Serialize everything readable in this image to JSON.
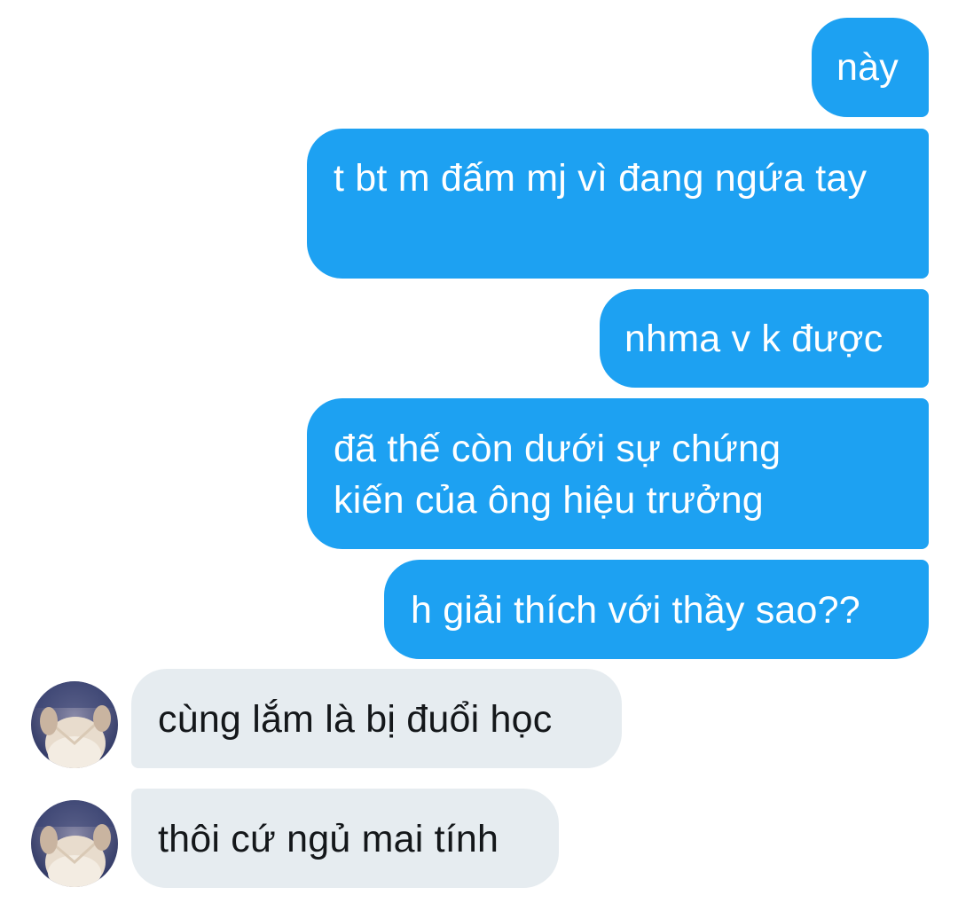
{
  "conversation": {
    "messages": [
      {
        "direction": "sent",
        "text": "này"
      },
      {
        "direction": "sent",
        "text": "t bt m đấm mj vì đang ngứa tay"
      },
      {
        "direction": "sent",
        "text": "nhma v k được"
      },
      {
        "direction": "sent",
        "text": "đã thế còn dưới sự chứng kiến của ông hiệu trưởng"
      },
      {
        "direction": "sent",
        "text": "h giải thích với thầy sao??"
      },
      {
        "direction": "received",
        "text": "cùng lắm là bị đuổi học"
      },
      {
        "direction": "received",
        "text": "thôi cứ ngủ mai tính"
      }
    ]
  },
  "colors": {
    "sent_bubble": "#1da1f2",
    "received_bubble": "#e6ecf0",
    "sent_text": "#ffffff",
    "received_text": "#14171a"
  },
  "icons": {
    "avatar": "user-avatar-photo"
  }
}
